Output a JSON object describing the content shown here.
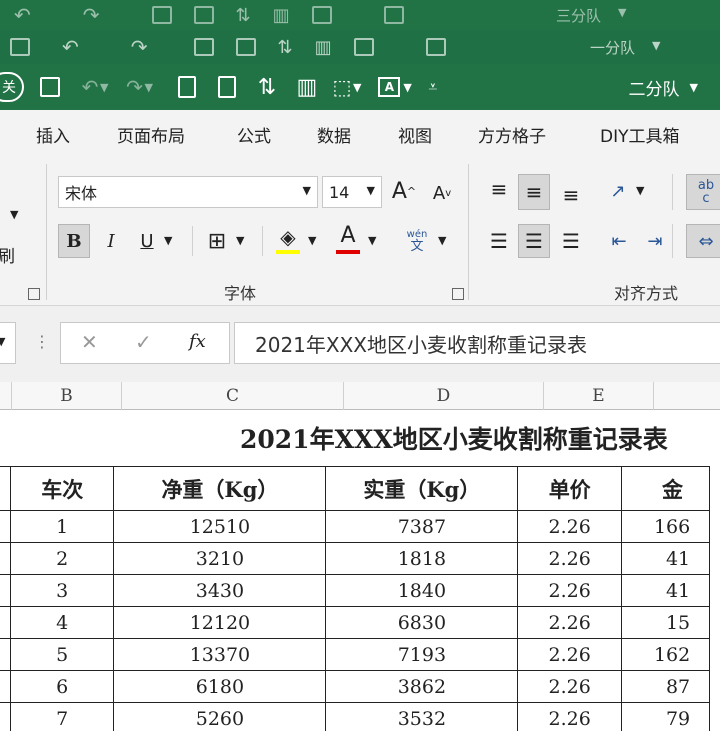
{
  "ghost_windows": [
    {
      "user": "三分队"
    },
    {
      "user": "一分队"
    }
  ],
  "titlebar": {
    "autosave_label": "关",
    "user": "二分队"
  },
  "ribbon_tabs": [
    "插入",
    "页面布局",
    "公式",
    "数据",
    "视图",
    "方方格子",
    "DIY工具箱"
  ],
  "font": {
    "name": "宋体",
    "size": "14",
    "group_label": "字体",
    "bold": "B",
    "italic": "I",
    "underline": "U",
    "font_color_glyph": "A",
    "grow": "A",
    "shrink": "A",
    "phonetic_top": "wén",
    "phonetic_bottom": "文",
    "fill_color": "#ffff00",
    "text_color": "#e00000"
  },
  "alignment": {
    "group_label": "对齐方式",
    "wrap_top": "ab",
    "wrap_bottom": "c"
  },
  "left_fragment": {
    "brush": "刷"
  },
  "formula_bar": {
    "cancel": "✕",
    "enter": "✓",
    "fx": "fx",
    "content": "2021年XXX地区小麦收割称重记录表"
  },
  "column_headers": [
    "B",
    "C",
    "D",
    "E"
  ],
  "sheet": {
    "title": "2021年XXX地区小麦收割称重记录表",
    "headers": [
      "车次",
      "净重（Kg）",
      "实重（Kg）",
      "单价",
      "金"
    ],
    "rows": [
      {
        "trip": "1",
        "net": "12510",
        "actual": "7387",
        "price": "2.26",
        "amount": "166"
      },
      {
        "trip": "2",
        "net": "3210",
        "actual": "1818",
        "price": "2.26",
        "amount": "41"
      },
      {
        "trip": "3",
        "net": "3430",
        "actual": "1840",
        "price": "2.26",
        "amount": "41"
      },
      {
        "trip": "4",
        "net": "12120",
        "actual": "6830",
        "price": "2.26",
        "amount": "15"
      },
      {
        "trip": "5",
        "net": "13370",
        "actual": "7193",
        "price": "2.26",
        "amount": "162"
      },
      {
        "trip": "6",
        "net": "6180",
        "actual": "3862",
        "price": "2.26",
        "amount": "87"
      },
      {
        "trip": "7",
        "net": "5260",
        "actual": "3532",
        "price": "2.26",
        "amount": "79"
      }
    ]
  },
  "colors": {
    "excel_green": "#217346",
    "ribbon_bg": "#f3f3f3"
  }
}
